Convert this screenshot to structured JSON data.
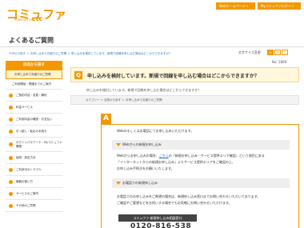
{
  "header": {
    "logo_text": "コミュファ",
    "logo_sub": "Powered by",
    "logo_brand": "ctc",
    "btn_home": "Webホームページへ",
    "btn_mypage": "Myコミュファログイン"
  },
  "page_title": "よくあるご質問",
  "breadcrumb": "TOPから探す ＞ お申し込みでお困りのご質問 ＞ 申し込みを検討しています。新規で回線を申し込む場合はどこからできますか？",
  "font_size": {
    "label": "文字サイズ変更",
    "small": "小",
    "medium": "中",
    "large": "大"
  },
  "sidebar": {
    "head": "目的から探す",
    "active": "お申し込みでお困りのご質問",
    "items": [
      {
        "label": "ご利用開始・開通までのご案内"
      },
      {
        "label": "ご契約内容・変更・解約"
      },
      {
        "label": "料金サービス"
      },
      {
        "label": "ご利用料金の確認・お支払い"
      },
      {
        "label": "引っ越し・転出の手続き"
      },
      {
        "label": "ログインパスワード・Myコミュファ関連"
      },
      {
        "label": "接続・設定方法"
      },
      {
        "label": "ご利用中のトラブル"
      },
      {
        "label": "機器の使い方"
      },
      {
        "label": "サービスのご案内"
      },
      {
        "label": "その他のご質問"
      }
    ]
  },
  "question": {
    "number": "No. 1809",
    "badge": "Q",
    "text": "申し込みを検討しています。新規で回線を申し込む場合はどこからできますか？",
    "sub": "申し込みを検討しています。新規で回線を申し込む場合はどこからできますか？",
    "category_path": "カテゴリー ＞ 目的から探す ＞ お申し込みでお困りのご質問"
  },
  "answer": {
    "badge": "A",
    "intro": "Webのもしくはお電話にてお申し込みいただけます。",
    "web_head": "Webからの新規お申し込み",
    "web_l1_a": "Webからお申し込みの場合、",
    "web_l1_link": "こちら",
    "web_l1_b": "の「新規お申し込み・サービス提供エリア確認」という項目にある",
    "web_l2": "「インターネットからの新規お申し込み」よりサービス提供エリアをご確認の上、",
    "web_l3": "お申し込み手続きをお願いいたします。",
    "tel_head": "お電話での新規申し込み",
    "tel_l1": "お電話でのお申し込みをご希望の場合は、新規申し込み窓口までお問い合わせいただいております。",
    "tel_l2": "ご確認やご要望などをお伺いする場合でもお気軽にお問い合わせいただけます。",
    "contact_bar": "コミュファ 新規申し込み相談窓口",
    "phone": "0120-816-538"
  }
}
